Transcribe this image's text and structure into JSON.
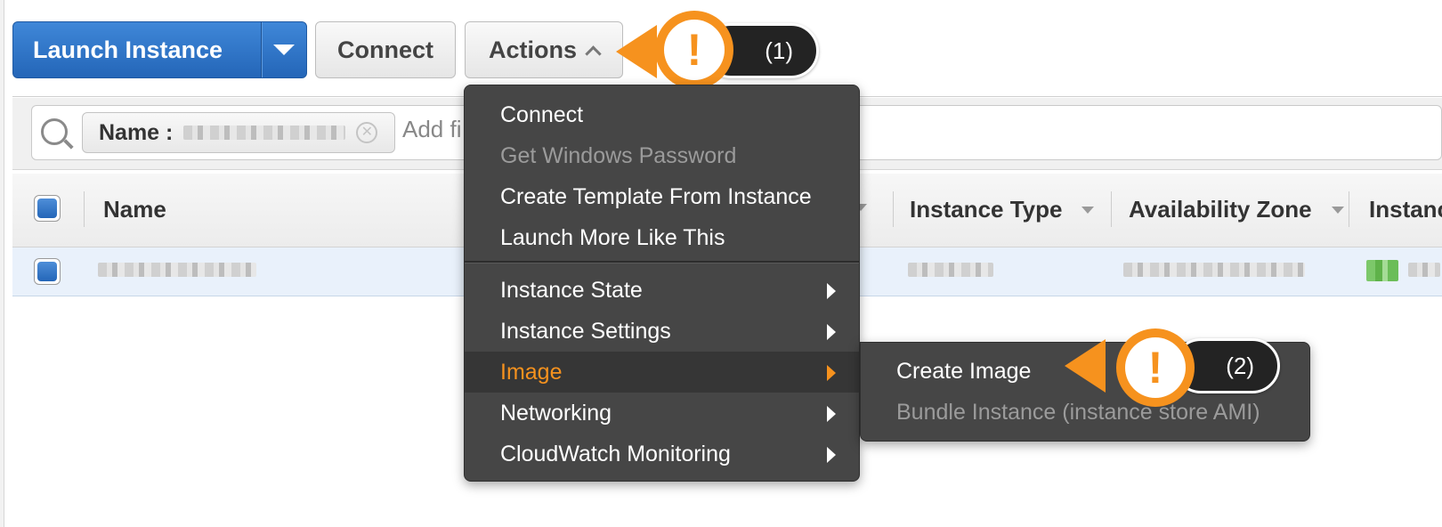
{
  "toolbar": {
    "launch_label": "Launch Instance",
    "connect_label": "Connect",
    "actions_label": "Actions"
  },
  "callouts": [
    {
      "label": "(1)",
      "symbol": "!"
    },
    {
      "label": "(2)",
      "symbol": "!"
    }
  ],
  "filter": {
    "token_key": "Name :",
    "placeholder": "Add fi"
  },
  "table": {
    "columns": [
      "Name",
      "Instance Type",
      "Availability Zone",
      "Instanc"
    ]
  },
  "actions_menu": {
    "items": [
      {
        "label": "Connect",
        "enabled": true
      },
      {
        "label": "Get Windows Password",
        "enabled": false
      },
      {
        "label": "Create Template From Instance",
        "enabled": true
      },
      {
        "label": "Launch More Like This",
        "enabled": true
      },
      {
        "label": "Instance State",
        "enabled": true,
        "submenu": true
      },
      {
        "label": "Instance Settings",
        "enabled": true,
        "submenu": true
      },
      {
        "label": "Image",
        "enabled": true,
        "submenu": true,
        "active": true
      },
      {
        "label": "Networking",
        "enabled": true,
        "submenu": true
      },
      {
        "label": "CloudWatch Monitoring",
        "enabled": true,
        "submenu": true
      }
    ]
  },
  "image_submenu": {
    "items": [
      {
        "label": "Create Image",
        "enabled": true
      },
      {
        "label": "Bundle Instance (instance store AMI)",
        "enabled": false
      }
    ]
  },
  "colors": {
    "primary": "#2466b8",
    "callout": "#f6921e",
    "menu_bg": "#464646",
    "active_item": "#f6921e"
  }
}
